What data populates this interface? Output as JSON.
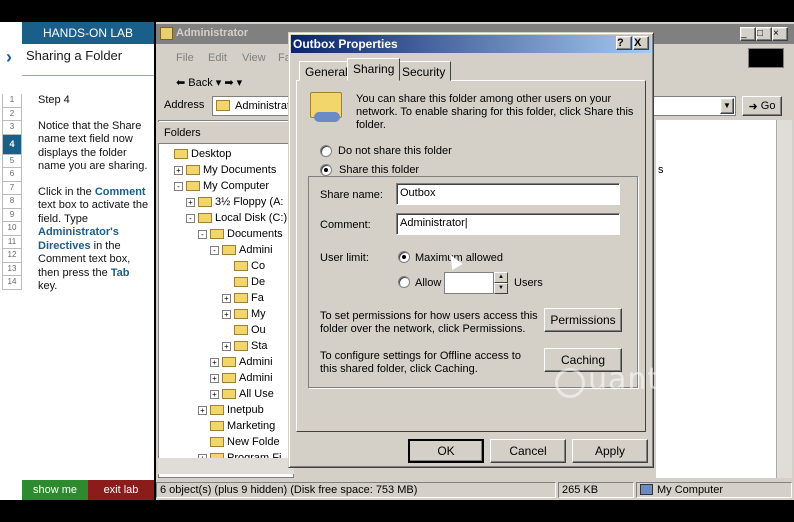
{
  "lab": {
    "header": "HANDS-ON LAB",
    "subtitle": "Sharing a Folder",
    "step_title": "Step 4",
    "steps": [
      "1",
      "2",
      "3",
      "4",
      "5",
      "6",
      "7",
      "8",
      "9",
      "10",
      "11",
      "12",
      "13",
      "14"
    ],
    "active_step": "4",
    "para1": "Notice that the Share name text field now displays the folder name you are sharing.",
    "para2_a": "Click in the ",
    "para2_hl1": "Comment",
    "para2_b": " text box to activate the field. Type ",
    "para2_hl2": "Administrator's Directives",
    "para2_c": " in the Comment text box, then press the ",
    "para2_hl3": "Tab",
    "para2_d": " key.",
    "show_me": "show me",
    "exit_lab": "exit lab"
  },
  "explorer": {
    "title": "Administrator",
    "menus": [
      "File",
      "Edit",
      "View",
      "Fa"
    ],
    "back_label": "Back",
    "address_label": "Address",
    "address_value": "Administrat",
    "go_label": "Go",
    "folders_header": "Folders",
    "tree": [
      {
        "label": "Desktop",
        "indent": 0,
        "exp": ""
      },
      {
        "label": "My Documents",
        "indent": 1,
        "exp": "+"
      },
      {
        "label": "My Computer",
        "indent": 1,
        "exp": "-"
      },
      {
        "label": "3½ Floppy (A:",
        "indent": 2,
        "exp": "+"
      },
      {
        "label": "Local Disk (C:)",
        "indent": 2,
        "exp": "-"
      },
      {
        "label": "Documents",
        "indent": 3,
        "exp": "-"
      },
      {
        "label": "Admini",
        "indent": 4,
        "exp": "-"
      },
      {
        "label": "Co",
        "indent": 5,
        "exp": ""
      },
      {
        "label": "De",
        "indent": 5,
        "exp": ""
      },
      {
        "label": "Fa",
        "indent": 5,
        "exp": "+"
      },
      {
        "label": "My",
        "indent": 5,
        "exp": "+"
      },
      {
        "label": "Ou",
        "indent": 5,
        "exp": ""
      },
      {
        "label": "Sta",
        "indent": 5,
        "exp": "+"
      },
      {
        "label": "Admini",
        "indent": 4,
        "exp": "+"
      },
      {
        "label": "Admini",
        "indent": 4,
        "exp": "+"
      },
      {
        "label": "All Use",
        "indent": 4,
        "exp": "+"
      },
      {
        "label": "Inetpub",
        "indent": 3,
        "exp": "+"
      },
      {
        "label": "Marketing",
        "indent": 3,
        "exp": ""
      },
      {
        "label": "New Folde",
        "indent": 3,
        "exp": ""
      },
      {
        "label": "Program Fi",
        "indent": 3,
        "exp": "+"
      }
    ],
    "right_fragment": "s",
    "status_objects": "6 object(s) (plus 9 hidden) (Disk free space: 753 MB)",
    "status_size": "265 KB",
    "status_location": "My Computer"
  },
  "dialog": {
    "title": "Outbox Properties",
    "help_btn": "?",
    "close_btn": "X",
    "tabs": [
      "General",
      "Sharing",
      "Security"
    ],
    "active_tab": "Sharing",
    "intro": "You can share this folder among other users on your network.  To enable sharing for this folder, click Share this folder.",
    "do_not_share": "Do not share this folder",
    "share_this": "Share this folder",
    "share_name_label": "Share name:",
    "share_name_value": "Outbox",
    "comment_label": "Comment:",
    "comment_value": "Administrator",
    "user_limit_label": "User limit:",
    "max_allowed": "Maximum allowed",
    "allow": "Allow",
    "users": "Users",
    "permissions_text": "To set permissions for how users access this folder over the network, click Permissions.",
    "permissions_btn": "Permissions",
    "caching_text": "To configure settings for Offline access to this shared folder, click Caching.",
    "caching_btn": "Caching",
    "ok": "OK",
    "cancel": "Cancel",
    "apply": "Apply"
  },
  "watermark": "uantrimang"
}
